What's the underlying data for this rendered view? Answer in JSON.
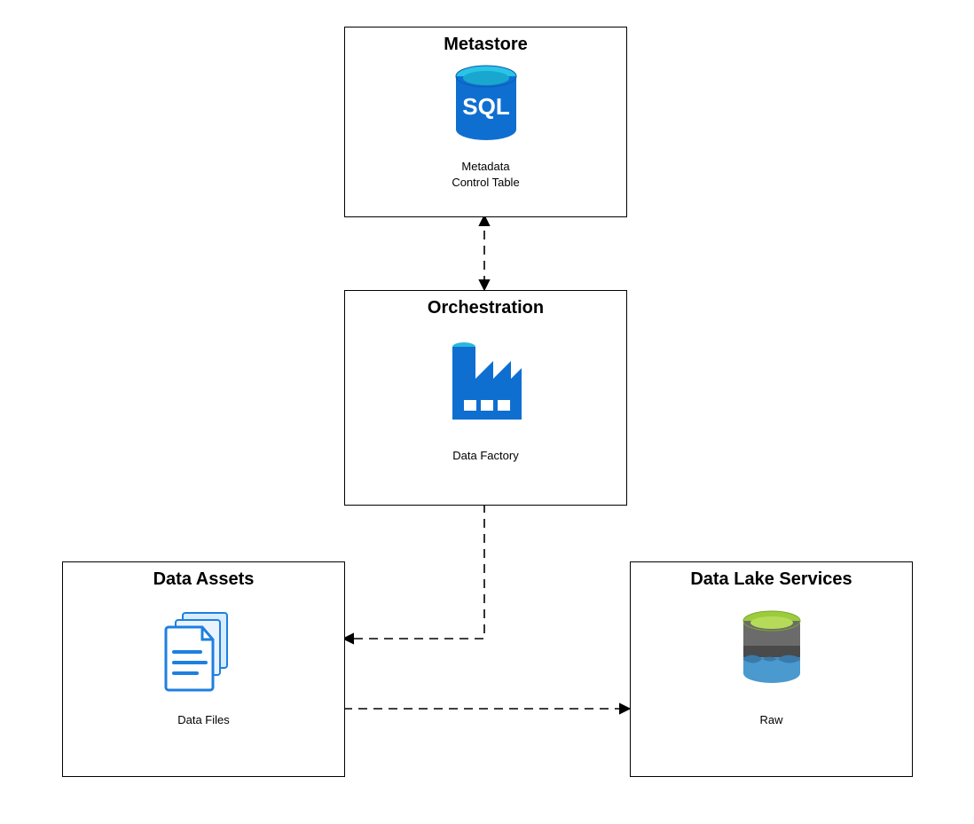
{
  "boxes": {
    "metastore": {
      "title": "Metastore",
      "caption_line1": "Metadata",
      "caption_line2": "Control Table",
      "icon_label": "SQL"
    },
    "orchestration": {
      "title": "Orchestration",
      "caption": "Data Factory"
    },
    "data_assets": {
      "title": "Data Assets",
      "caption": "Data Files"
    },
    "data_lake": {
      "title": "Data Lake Services",
      "caption": "Raw"
    }
  }
}
